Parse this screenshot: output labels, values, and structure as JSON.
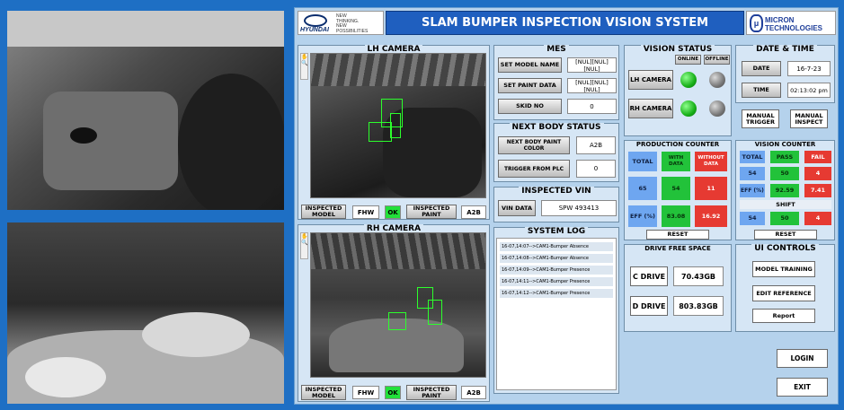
{
  "header": {
    "brand_name": "HYUNDAI",
    "brand_tagline_1": "NEW",
    "brand_tagline_2": "THINKING.",
    "brand_tagline_3": "NEW",
    "brand_tagline_4": "POSSIBILITIES",
    "title": "SLAM BUMPER INSPECTION VISION SYSTEM",
    "partner_line1": "MICRON",
    "partner_line2": "TECHNOLOGIES"
  },
  "lh_camera": {
    "title": "LH CAMERA",
    "inspected_model_label": "INSPECTED MODEL",
    "model_value": "FHW",
    "ok_value": "OK",
    "inspected_paint_label": "INSPECTED PAINT",
    "paint_value": "A2B"
  },
  "rh_camera": {
    "title": "RH CAMERA",
    "inspected_model_label": "INSPECTED MODEL",
    "model_value": "FHW",
    "ok_value": "OK",
    "inspected_paint_label": "INSPECTED PAINT",
    "paint_value": "A2B"
  },
  "mes": {
    "title": "MES",
    "set_model_name_label": "SET MODEL NAME",
    "set_model_name_value": "[NUL][NUL][NUL]",
    "set_paint_data_label": "SET PAINT DATA",
    "set_paint_data_value": "[NUL][NUL][NUL]",
    "skid_no_label": "SKID NO",
    "skid_no_value": "0"
  },
  "next_body": {
    "title": "NEXT BODY STATUS",
    "paint_color_label": "NEXT BODY PAINT COLOR",
    "paint_color_value": "A2B",
    "trigger_label": "TRIGGER FROM PLC",
    "trigger_value": "0"
  },
  "vin": {
    "title": "INSPECTED VIN",
    "label": "VIN DATA",
    "value": "SPW 493413"
  },
  "system_log": {
    "title": "SYSTEM LOG",
    "entries": [
      "16-07,14:07-->CAM1-Bumper Absence",
      "16-07,14:08-->CAM1-Bumper Absence",
      "16-07,14:09-->CAM1-Bumper Presence",
      "16-07,14:11-->CAM1-Bumper Presence",
      "16-07,14:12-->CAM1-Bumper Presence"
    ]
  },
  "vision_status": {
    "title": "VISION STATUS",
    "online_label": "ONLINE",
    "offline_label": "OFFLINE",
    "lh_label": "LH CAMERA",
    "rh_label": "RH CAMERA",
    "lh_online": true,
    "rh_online": true
  },
  "date_time": {
    "title": "DATE & TIME",
    "date_label": "DATE",
    "date_value": "16-7-23",
    "time_label": "TIME",
    "time_value": "02:13:02 pm",
    "manual_trigger_label": "MANUAL TRIGGER",
    "manual_inspect_label": "MANUAL INSPECT"
  },
  "production_counter": {
    "title": "PRODUCTION COUNTER",
    "total_label": "TOTAL",
    "with_data_label": "WITH DATA",
    "without_data_label": "WITHOUT DATA",
    "total_value": "65",
    "with_value": "54",
    "without_value": "11",
    "eff_label": "EFF (%)",
    "eff_with": "83.08",
    "eff_without": "16.92",
    "reset_label": "RESET"
  },
  "vision_counter": {
    "title": "VISION COUNTER",
    "total_label": "TOTAL",
    "pass_label": "PASS",
    "fail_label": "FAIL",
    "total_value": "54",
    "pass_value": "50",
    "fail_value": "4",
    "eff_label": "EFF (%)",
    "eff_pass": "92.59",
    "eff_fail": "7.41",
    "shift_label": "SHIFT",
    "shift_total": "54",
    "shift_pass": "50",
    "shift_fail": "4",
    "reset_label": "RESET"
  },
  "drive": {
    "title": "DRIVE FREE SPACE",
    "c_label": "C DRIVE",
    "c_value": "70.43GB",
    "d_label": "D DRIVE",
    "d_value": "803.83GB"
  },
  "ui_controls": {
    "title": "UI CONTROLS",
    "model_training": "MODEL TRAINING",
    "edit_reference": "EDIT REFERENCE",
    "report": "Report",
    "login": "LOGIN",
    "exit": "EXIT"
  },
  "colors": {
    "background": "#1e6fc4",
    "title_bar": "#1f5fbf",
    "ok_green": "#22c23a",
    "fail_red": "#e63a32",
    "counter_blue": "#6ea6f0"
  }
}
